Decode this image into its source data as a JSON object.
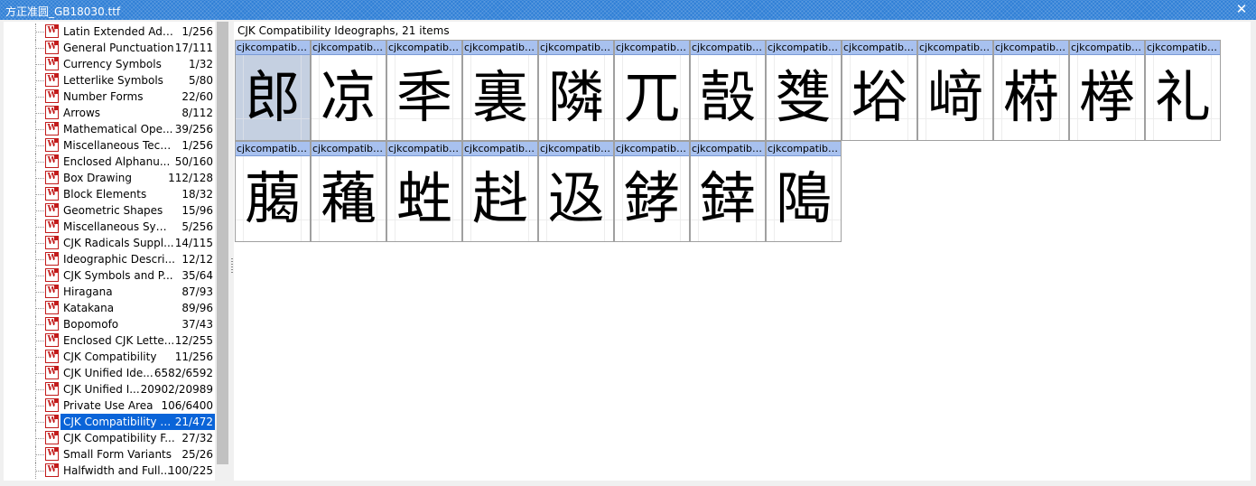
{
  "window": {
    "title": "方正准圆_GB18030.ttf",
    "close_symbol": "✕"
  },
  "sidebar": {
    "icon_glyph": "W",
    "items": [
      {
        "label": "Latin Extended Addi...",
        "count": "1/256"
      },
      {
        "label": "General Punctuation",
        "count": "17/111"
      },
      {
        "label": "Currency Symbols",
        "count": "1/32"
      },
      {
        "label": "Letterlike Symbols",
        "count": "5/80"
      },
      {
        "label": "Number Forms",
        "count": "22/60"
      },
      {
        "label": "Arrows",
        "count": "8/112"
      },
      {
        "label": "Mathematical Ope...",
        "count": "39/256"
      },
      {
        "label": "Miscellaneous Tech...",
        "count": "1/256"
      },
      {
        "label": "Enclosed Alphanu...",
        "count": "50/160"
      },
      {
        "label": "Box Drawing",
        "count": "112/128"
      },
      {
        "label": "Block Elements",
        "count": "18/32"
      },
      {
        "label": "Geometric Shapes",
        "count": "15/96"
      },
      {
        "label": "Miscellaneous Sym...",
        "count": "5/256"
      },
      {
        "label": "CJK Radicals Suppl...",
        "count": "14/115"
      },
      {
        "label": "Ideographic Descri...",
        "count": "12/12"
      },
      {
        "label": "CJK Symbols and P...",
        "count": "35/64"
      },
      {
        "label": "Hiragana",
        "count": "87/93"
      },
      {
        "label": "Katakana",
        "count": "89/96"
      },
      {
        "label": "Bopomofo",
        "count": "37/43"
      },
      {
        "label": "Enclosed CJK Lette...",
        "count": "12/255"
      },
      {
        "label": "CJK Compatibility",
        "count": "11/256"
      },
      {
        "label": "CJK Unified Ide...",
        "count": "6582/6592"
      },
      {
        "label": "CJK Unified I...",
        "count": "20902/20989"
      },
      {
        "label": "Private Use Area",
        "count": "106/6400"
      },
      {
        "label": "CJK Compatibility I...",
        "count": "21/472",
        "selected": true
      },
      {
        "label": "CJK Compatibility F...",
        "count": "27/32"
      },
      {
        "label": "Small Form Variants",
        "count": "25/26"
      },
      {
        "label": "Halfwidth and Full...",
        "count": "100/225"
      }
    ]
  },
  "main": {
    "header": "CJK Compatibility Ideographs, 21 items",
    "cell_caption": "cjkcompatibil...",
    "glyphs": [
      {
        "char": "郎",
        "selected": true
      },
      {
        "char": "凉"
      },
      {
        "char": "秊"
      },
      {
        "char": "裏"
      },
      {
        "char": "隣"
      },
      {
        "char": "兀"
      },
      {
        "char": "嗀"
      },
      {
        "char": "﨎"
      },
      {
        "char": "﨏"
      },
      {
        "char": "﨑"
      },
      {
        "char": "﨓"
      },
      {
        "char": "﨔"
      },
      {
        "char": "礼"
      },
      {
        "char": "﨟"
      },
      {
        "char": "蘒"
      },
      {
        "char": "﨡"
      },
      {
        "char": "﨣"
      },
      {
        "char": "﨤"
      },
      {
        "char": "﨧"
      },
      {
        "char": "﨨"
      },
      {
        "char": "﨩"
      }
    ]
  },
  "colors": {
    "titlebar": "#2f7fd6",
    "selection": "#0a64d8",
    "caption_bg": "#a8c1ef",
    "selected_cell": "#c5d0e1"
  }
}
